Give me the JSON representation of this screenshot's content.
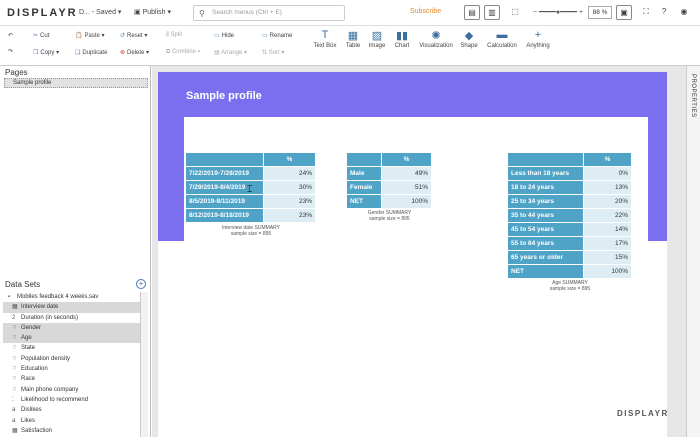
{
  "topbar": {
    "logo": "DISPLAYR",
    "doc_name": "D... - Saved",
    "publish": "Publish",
    "search_placeholder": "Search menus (Ctrl + E)",
    "subscribe": "Subscribe",
    "zoom": "88 %"
  },
  "ribbon": {
    "cut": "Cut",
    "paste": "Paste",
    "reset": "Reset",
    "split": "Split",
    "hide": "Hide",
    "rename": "Rename",
    "copy": "Copy",
    "duplicate": "Duplicate",
    "delete": "Delete",
    "combine": "Combine",
    "arrange": "Arrange",
    "sort": "Sort",
    "text_box": "Text Box",
    "table": "Table",
    "image": "Image",
    "chart": "Chart",
    "visualization": "Visualization",
    "shape": "Shape",
    "calculation": "Calculation",
    "anything": "Anything"
  },
  "pages": {
    "title": "Pages",
    "items": [
      "Sample profile"
    ]
  },
  "datasets": {
    "title": "Data Sets",
    "file": "Mobiles feedback 4 weeks.sav",
    "items": [
      {
        "label": "Interview date",
        "icon": "calendar-icon",
        "selected": true
      },
      {
        "label": "Duration (in seconds)",
        "icon": "numeric-icon",
        "selected": false
      },
      {
        "label": "Gender",
        "icon": "categorical-icon",
        "selected": true
      },
      {
        "label": "Age",
        "icon": "categorical-icon",
        "selected": true
      },
      {
        "label": "State",
        "icon": "categorical-icon",
        "selected": false
      },
      {
        "label": "Population density",
        "icon": "categorical-icon",
        "selected": false
      },
      {
        "label": "Education",
        "icon": "categorical-icon",
        "selected": false
      },
      {
        "label": "Race",
        "icon": "categorical-icon",
        "selected": false
      },
      {
        "label": "Main phone company",
        "icon": "categorical-icon",
        "selected": false
      },
      {
        "label": "Likelihood to recommend",
        "icon": "ordinal-icon",
        "selected": false
      },
      {
        "label": "Dislikes",
        "icon": "text-icon",
        "selected": false
      },
      {
        "label": "Likes",
        "icon": "text-icon",
        "selected": false
      },
      {
        "label": "Satisfaction",
        "icon": "grid-icon",
        "selected": false
      }
    ]
  },
  "canvas": {
    "page_title": "Sample profile",
    "brand": "DISPLAYR",
    "tables": [
      {
        "header": "%",
        "rows": [
          {
            "label": "7/22/2019-7/28/2019",
            "value": "24%"
          },
          {
            "label": "7/29/2019-8/4/2019",
            "value": "30%"
          },
          {
            "label": "8/5/2019-8/11/2019",
            "value": "23%"
          },
          {
            "label": "8/12/2019-8/18/2019",
            "value": "23%"
          }
        ],
        "footer1": "Interview date SUMMARY",
        "footer2": "sample size = 895"
      },
      {
        "header": "%",
        "rows": [
          {
            "label": "Male",
            "value": "49%"
          },
          {
            "label": "Female",
            "value": "51%"
          },
          {
            "label": "NET",
            "value": "100%"
          }
        ],
        "footer1": "Gender SUMMARY",
        "footer2": "sample size = 895"
      },
      {
        "header": "%",
        "rows": [
          {
            "label": "Less than 18 years",
            "value": "0%"
          },
          {
            "label": "18 to 24 years",
            "value": "13%"
          },
          {
            "label": "25 to 34 years",
            "value": "20%"
          },
          {
            "label": "35 to 44 years",
            "value": "22%"
          },
          {
            "label": "45 to 54 years",
            "value": "14%"
          },
          {
            "label": "55 to 64 years",
            "value": "17%"
          },
          {
            "label": "65 years or older",
            "value": "15%"
          },
          {
            "label": "NET",
            "value": "100%"
          }
        ],
        "footer1": "Age SUMMARY",
        "footer2": "sample size = 895"
      }
    ]
  },
  "right_panel": {
    "label": "PROPERTIES"
  },
  "colors": {
    "band": "#7b6ff0",
    "table_header": "#4fa3c7",
    "table_value": "#ddedf3",
    "subscribe": "#e58a2e"
  }
}
